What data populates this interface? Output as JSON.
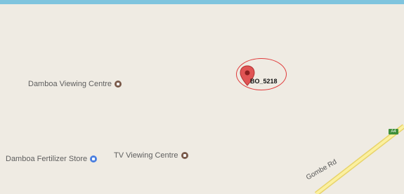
{
  "map": {
    "marker_label": "BO_5218",
    "road_label": "Gombe Rd",
    "road_shield": "A4",
    "pois": [
      {
        "name": "Damboa Viewing Centre",
        "icon": "circle-generic-icon"
      },
      {
        "name": "Damboa Fertilizer Store",
        "icon": "shopping-bag-icon"
      },
      {
        "name": "TV Viewing Centre",
        "icon": "circle-generic-icon"
      }
    ],
    "colors": {
      "background": "#efebe3",
      "water_edge": "#7fc4de",
      "marker": "#e05454",
      "ring": "#e03b3b",
      "road": "#f7e36d"
    }
  }
}
